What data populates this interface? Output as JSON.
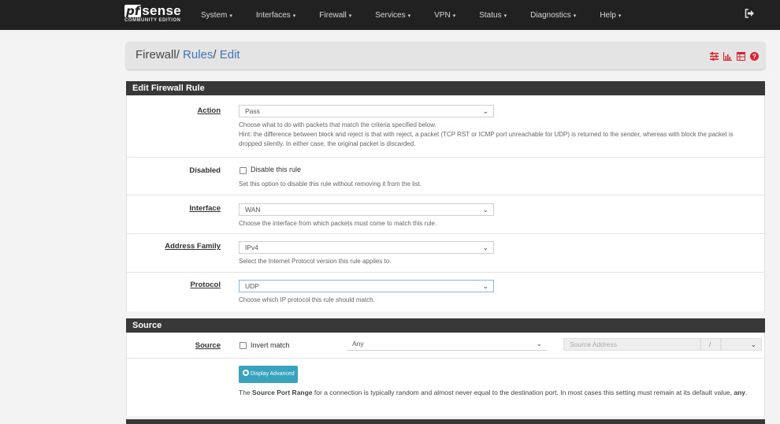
{
  "navbar": {
    "brand_pf": "pf",
    "brand_sense": "sense",
    "brand_edition": "COMMUNITY EDITION",
    "items": [
      {
        "label": "System"
      },
      {
        "label": "Interfaces"
      },
      {
        "label": "Firewall"
      },
      {
        "label": "Services"
      },
      {
        "label": "VPN"
      },
      {
        "label": "Status"
      },
      {
        "label": "Diagnostics"
      },
      {
        "label": "Help"
      }
    ],
    "caret": "▾"
  },
  "breadcrumb": {
    "root": "Firewall",
    "sep1": "/",
    "rules": "Rules",
    "sep2": "/",
    "current": "Edit",
    "icons": [
      "sliders-icon",
      "chart-icon",
      "table-icon",
      "help-icon"
    ]
  },
  "edit_panel": {
    "title": "Edit Firewall Rule",
    "action": {
      "label": "Action",
      "value": "Pass",
      "help1": "Choose what to do with packets that match the criteria specified below.",
      "help2": "Hint: the difference between block and reject is that with reject, a packet (TCP RST or ICMP port unreachable for UDP) is returned to the sender, whereas with block the packet is dropped silently. In either case, the original packet is discarded."
    },
    "disabled": {
      "label": "Disabled",
      "check_label": "Disable this rule",
      "checked": false,
      "help": "Set this option to disable this rule without removing it from the list."
    },
    "interface": {
      "label": "Interface",
      "value": "WAN",
      "help": "Choose the interface from which packets must come to match this rule."
    },
    "address_family": {
      "label": "Address Family",
      "value": "IPv4",
      "help": "Select the Internet Protocol version this rule applies to."
    },
    "protocol": {
      "label": "Protocol",
      "value": "UDP",
      "help": "Choose which IP protocol this rule should match."
    }
  },
  "source_panel": {
    "title": "Source",
    "source": {
      "label": "Source",
      "invert_label": "Invert match",
      "invert_checked": false,
      "type_value": "Any",
      "address_placeholder": "Source Address",
      "slash": "/",
      "mask_value": ""
    },
    "advanced": {
      "button_label": "Display Advanced",
      "help_pre": "The ",
      "help_bold1": "Source Port Range",
      "help_mid": " for a connection is typically random and almost never equal to the destination port. In most cases this setting must remain at its default value, ",
      "help_bold2": "any",
      "help_post": "."
    }
  },
  "colors": {
    "navbar": "#212121",
    "panel_header": "#383838",
    "link": "#3f74b8",
    "button": "#37a3bf",
    "icon_red": "#d9232d"
  }
}
